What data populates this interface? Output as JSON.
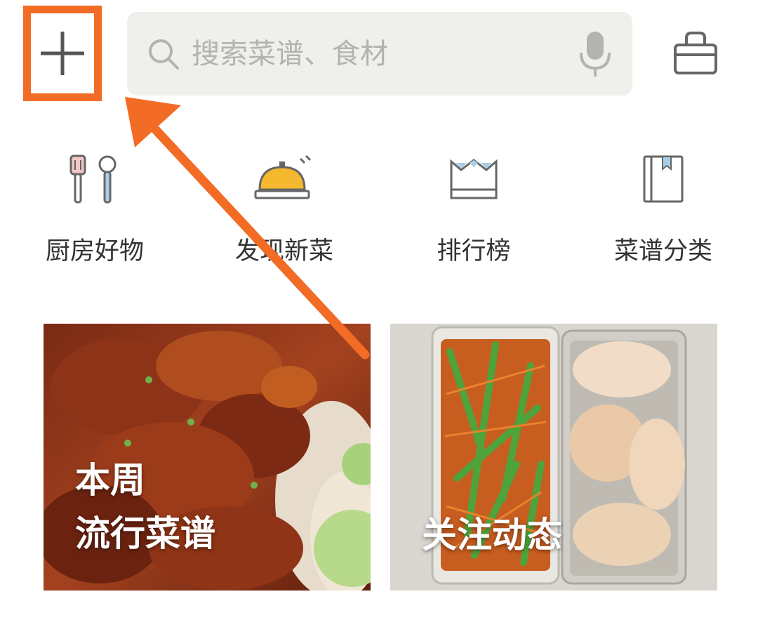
{
  "header": {
    "search_placeholder": "搜索菜谱、食材"
  },
  "quick_nav": [
    {
      "label": "厨房好物",
      "icon": "kitchen-tools-icon"
    },
    {
      "label": "发现新菜",
      "icon": "service-bell-icon"
    },
    {
      "label": "排行榜",
      "icon": "crown-icon"
    },
    {
      "label": "菜谱分类",
      "icon": "bookmarked-book-icon"
    }
  ],
  "cards": [
    {
      "line1": "本周",
      "line2": "流行菜谱"
    },
    {
      "line1": "关注动态"
    }
  ],
  "colors": {
    "highlight": "#f26c25",
    "search_bg": "#efefec",
    "icon_stroke": "#6b6b66",
    "bell_yellow": "#f5b82e"
  }
}
